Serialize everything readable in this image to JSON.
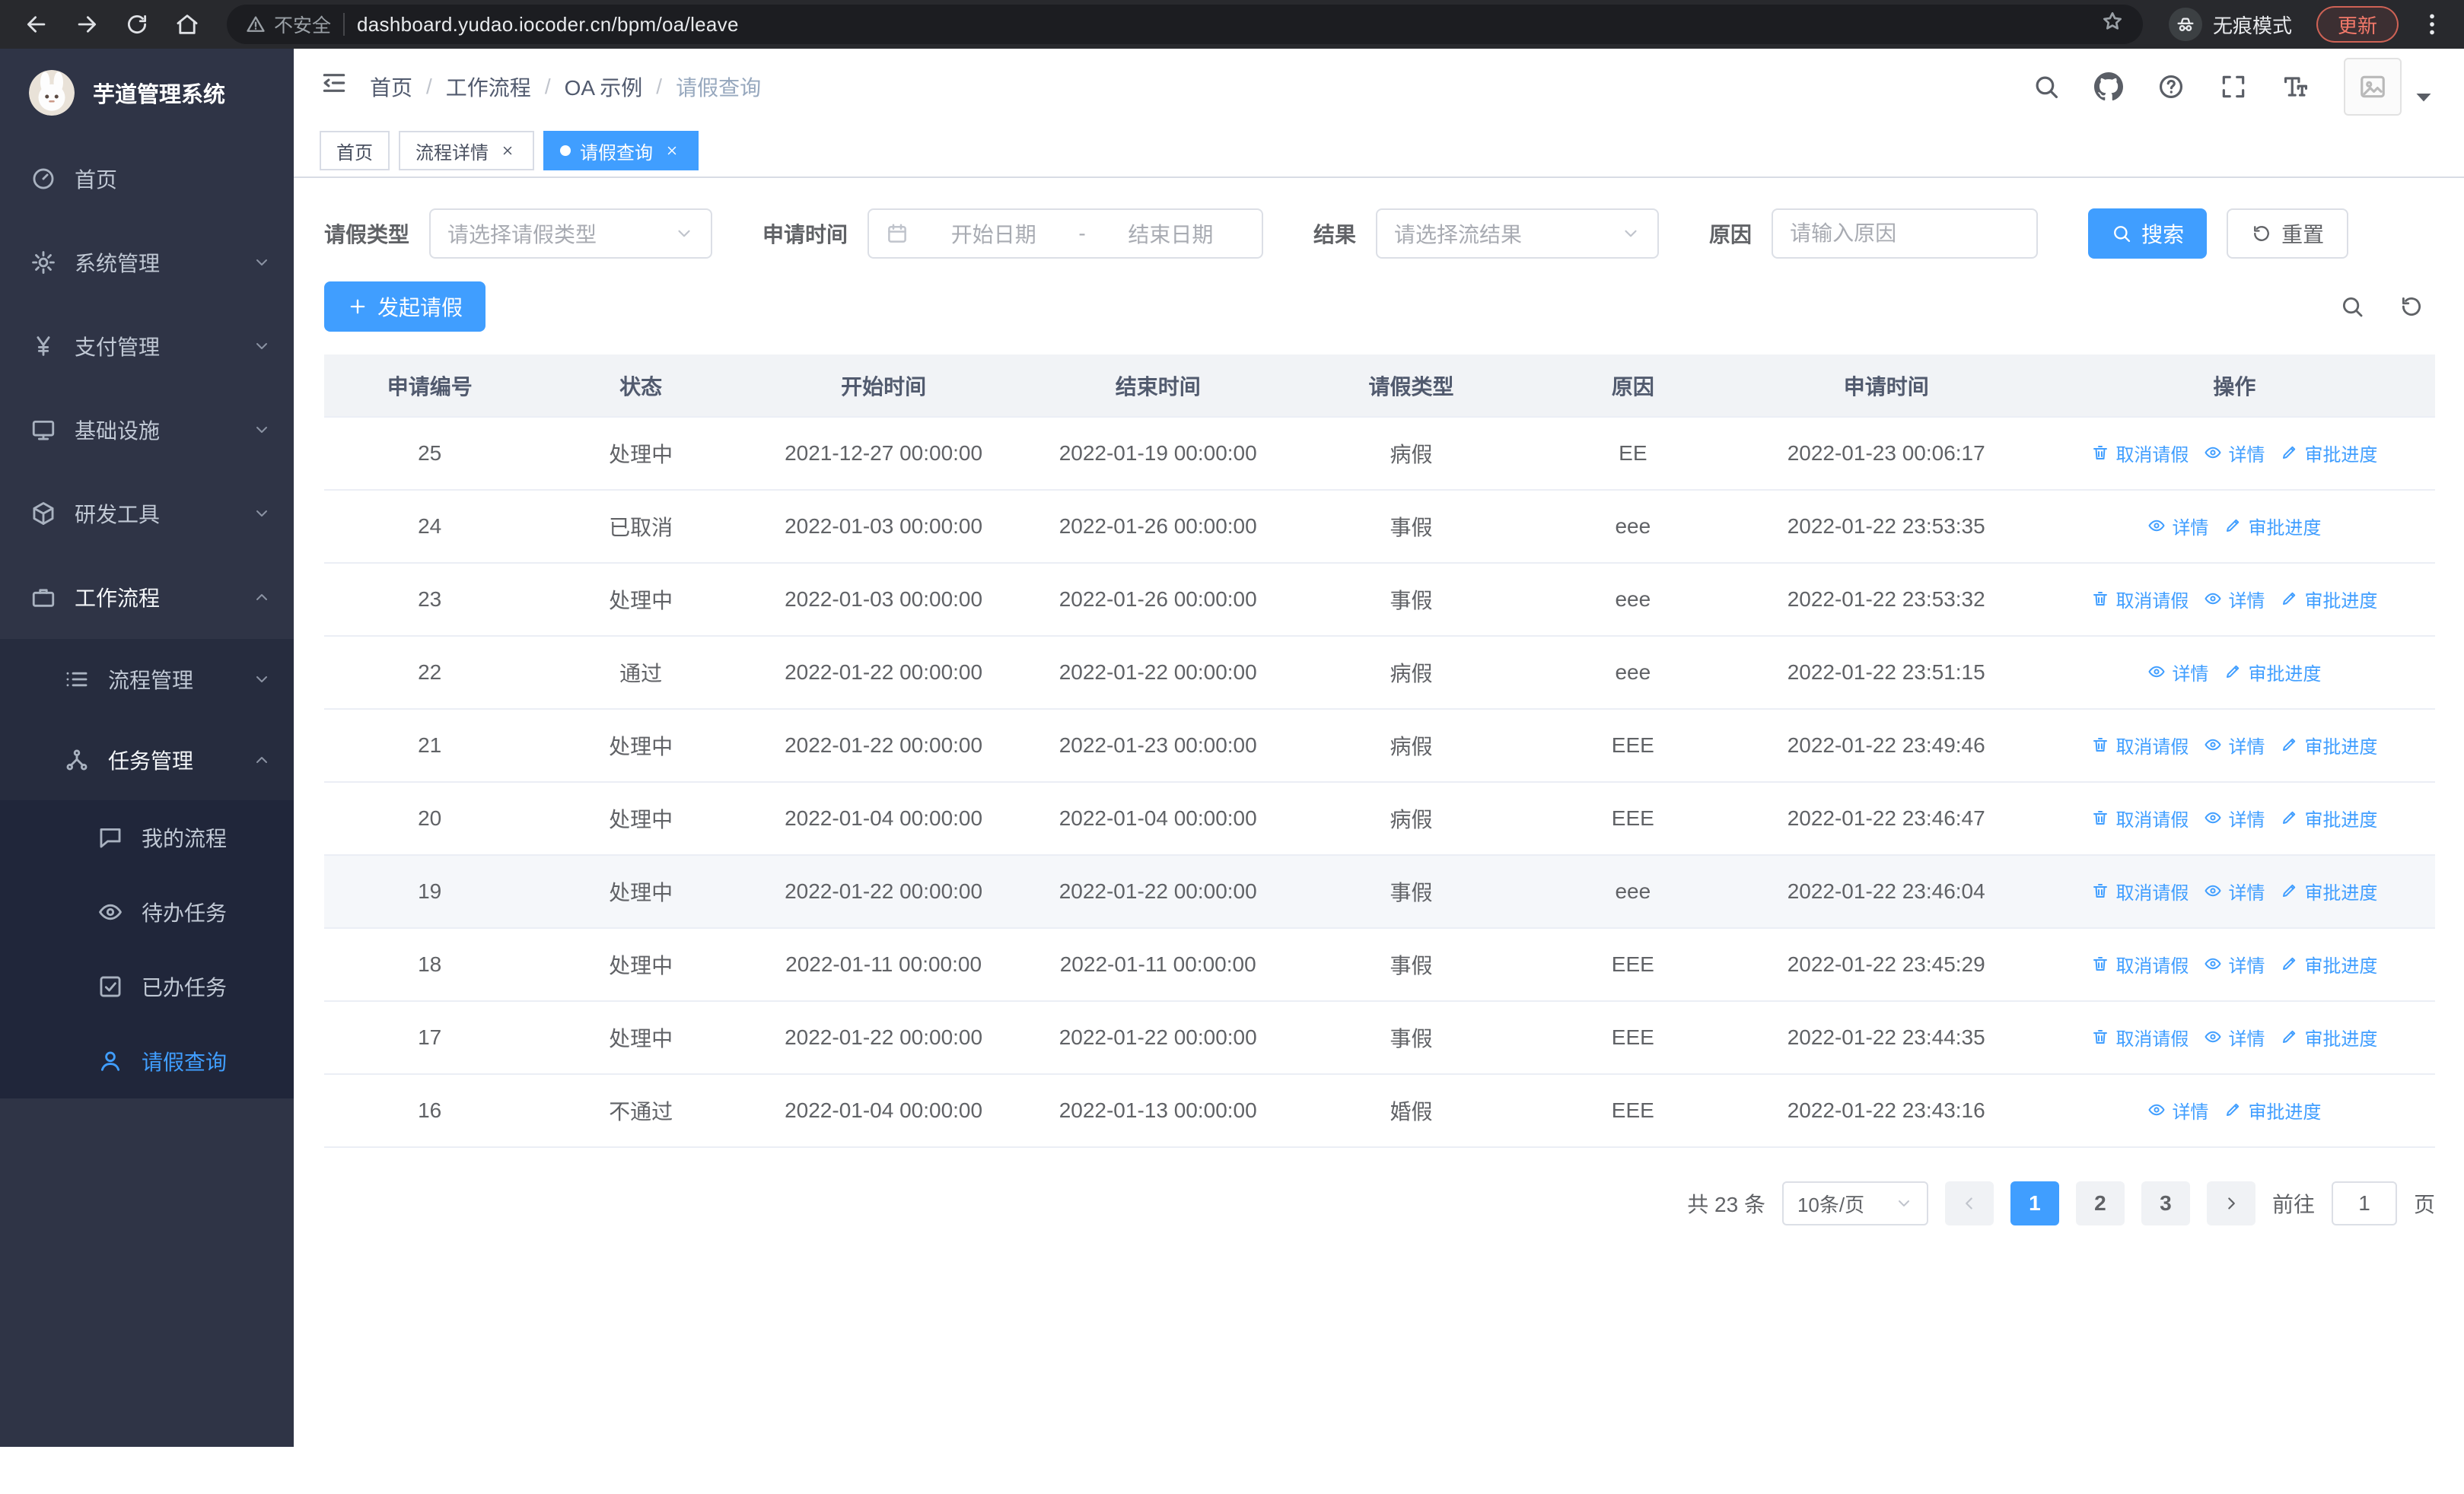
{
  "browser": {
    "security_label": "不安全",
    "url": "dashboard.yudao.iocoder.cn/bpm/oa/leave",
    "incognito_label": "无痕模式",
    "update_label": "更新"
  },
  "colors": {
    "primary": "#409eff",
    "sidebar_bg": "#2f3446",
    "sidebar_sub_bg": "#262c3e",
    "sidebar_subsub_bg": "#20263a"
  },
  "sidebar": {
    "logo_title": "芋道管理系统",
    "items": [
      {
        "name": "home",
        "label": "首页",
        "icon": "dashboard-icon",
        "level": 0
      },
      {
        "name": "system-management",
        "label": "系统管理",
        "icon": "gear-icon",
        "level": 0,
        "chevron": "down"
      },
      {
        "name": "payment-management",
        "label": "支付管理",
        "icon": "yen-icon",
        "level": 0,
        "chevron": "down"
      },
      {
        "name": "infrastructure",
        "label": "基础设施",
        "icon": "monitor-icon",
        "level": 0,
        "chevron": "down"
      },
      {
        "name": "dev-tools",
        "label": "研发工具",
        "icon": "cube-icon",
        "level": 0,
        "chevron": "down"
      },
      {
        "name": "workflow",
        "label": "工作流程",
        "icon": "briefcase-icon",
        "level": 0,
        "chevron": "up",
        "open": true
      },
      {
        "name": "process-management",
        "label": "流程管理",
        "icon": "list-icon",
        "level": 1,
        "chevron": "down"
      },
      {
        "name": "task-management",
        "label": "任务管理",
        "icon": "share-icon",
        "level": 1,
        "chevron": "up",
        "open": true
      },
      {
        "name": "my-process",
        "label": "我的流程",
        "icon": "chat-icon",
        "level": 2
      },
      {
        "name": "todo-tasks",
        "label": "待办任务",
        "icon": "eye-icon",
        "level": 2
      },
      {
        "name": "done-tasks",
        "label": "已办任务",
        "icon": "check-square-icon",
        "level": 2
      },
      {
        "name": "leave-query",
        "label": "请假查询",
        "icon": "user-icon",
        "level": 2,
        "active": true
      }
    ]
  },
  "breadcrumb": [
    "首页",
    "工作流程",
    "OA 示例",
    "请假查询"
  ],
  "tabs": [
    {
      "name": "home",
      "label": "首页",
      "closable": false,
      "active": false
    },
    {
      "name": "process-detail",
      "label": "流程详情",
      "closable": true,
      "active": false
    },
    {
      "name": "leave-query",
      "label": "请假查询",
      "closable": true,
      "active": true
    }
  ],
  "filters": {
    "leave_type_label": "请假类型",
    "leave_type_placeholder": "请选择请假类型",
    "apply_time_label": "申请时间",
    "start_placeholder": "开始日期",
    "range_separator": "-",
    "end_placeholder": "结束日期",
    "result_label": "结果",
    "result_placeholder": "请选择流结果",
    "reason_label": "原因",
    "reason_placeholder": "请输入原因",
    "search_label": "搜索",
    "reset_label": "重置"
  },
  "toolbar": {
    "create_label": "发起请假"
  },
  "table": {
    "columns": [
      "申请编号",
      "状态",
      "开始时间",
      "结束时间",
      "请假类型",
      "原因",
      "申请时间",
      "操作"
    ],
    "action_labels": {
      "cancel": "取消请假",
      "detail": "详情",
      "progress": "审批进度"
    },
    "rows": [
      {
        "id": "25",
        "status": "处理中",
        "start": "2021-12-27 00:00:00",
        "end": "2022-01-19 00:00:00",
        "type": "病假",
        "reason": "EE",
        "applied": "2022-01-23 00:06:17",
        "actions": [
          "cancel",
          "detail",
          "progress"
        ]
      },
      {
        "id": "24",
        "status": "已取消",
        "start": "2022-01-03 00:00:00",
        "end": "2022-01-26 00:00:00",
        "type": "事假",
        "reason": "eee",
        "applied": "2022-01-22 23:53:35",
        "actions": [
          "detail",
          "progress"
        ]
      },
      {
        "id": "23",
        "status": "处理中",
        "start": "2022-01-03 00:00:00",
        "end": "2022-01-26 00:00:00",
        "type": "事假",
        "reason": "eee",
        "applied": "2022-01-22 23:53:32",
        "actions": [
          "cancel",
          "detail",
          "progress"
        ]
      },
      {
        "id": "22",
        "status": "通过",
        "start": "2022-01-22 00:00:00",
        "end": "2022-01-22 00:00:00",
        "type": "病假",
        "reason": "eee",
        "applied": "2022-01-22 23:51:15",
        "actions": [
          "detail",
          "progress"
        ]
      },
      {
        "id": "21",
        "status": "处理中",
        "start": "2022-01-22 00:00:00",
        "end": "2022-01-23 00:00:00",
        "type": "病假",
        "reason": "EEE",
        "applied": "2022-01-22 23:49:46",
        "actions": [
          "cancel",
          "detail",
          "progress"
        ]
      },
      {
        "id": "20",
        "status": "处理中",
        "start": "2022-01-04 00:00:00",
        "end": "2022-01-04 00:00:00",
        "type": "病假",
        "reason": "EEE",
        "applied": "2022-01-22 23:46:47",
        "actions": [
          "cancel",
          "detail",
          "progress"
        ]
      },
      {
        "id": "19",
        "status": "处理中",
        "start": "2022-01-22 00:00:00",
        "end": "2022-01-22 00:00:00",
        "type": "事假",
        "reason": "eee",
        "applied": "2022-01-22 23:46:04",
        "actions": [
          "cancel",
          "detail",
          "progress"
        ],
        "highlighted": true
      },
      {
        "id": "18",
        "status": "处理中",
        "start": "2022-01-11 00:00:00",
        "end": "2022-01-11 00:00:00",
        "type": "事假",
        "reason": "EEE",
        "applied": "2022-01-22 23:45:29",
        "actions": [
          "cancel",
          "detail",
          "progress"
        ]
      },
      {
        "id": "17",
        "status": "处理中",
        "start": "2022-01-22 00:00:00",
        "end": "2022-01-22 00:00:00",
        "type": "事假",
        "reason": "EEE",
        "applied": "2022-01-22 23:44:35",
        "actions": [
          "cancel",
          "detail",
          "progress"
        ]
      },
      {
        "id": "16",
        "status": "不通过",
        "start": "2022-01-04 00:00:00",
        "end": "2022-01-13 00:00:00",
        "type": "婚假",
        "reason": "EEE",
        "applied": "2022-01-22 23:43:16",
        "actions": [
          "detail",
          "progress"
        ]
      }
    ]
  },
  "pagination": {
    "total_label": "共 23 条",
    "page_size_label": "10条/页",
    "pages": [
      "1",
      "2",
      "3"
    ],
    "active_page": "1",
    "goto_label": "前往",
    "goto_value": "1",
    "goto_unit": "页"
  }
}
